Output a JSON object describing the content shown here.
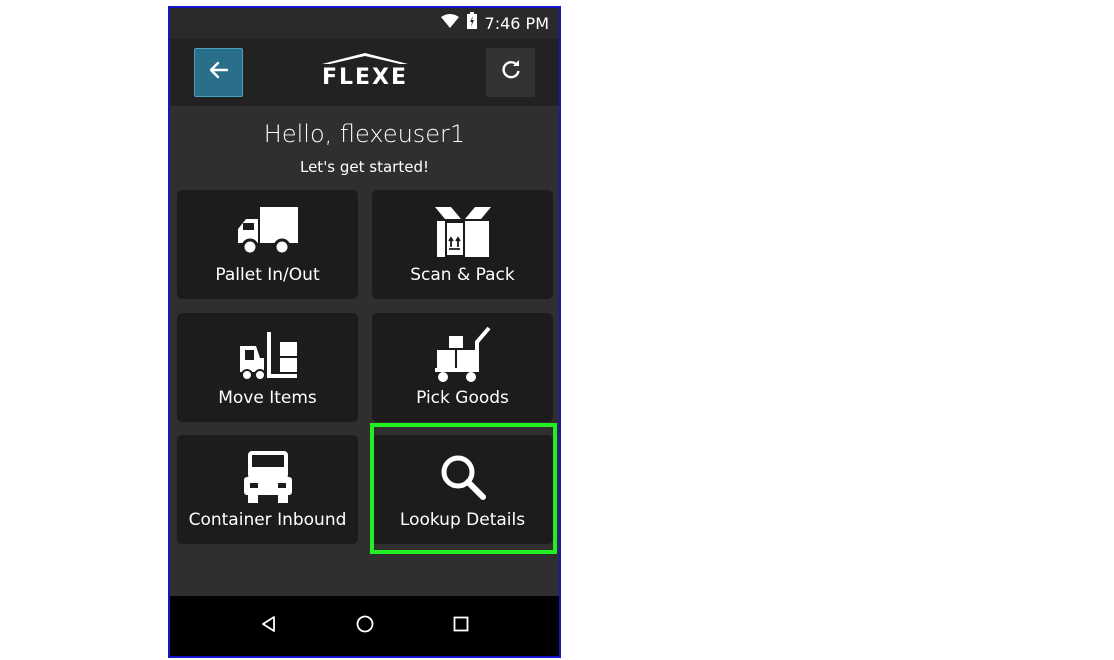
{
  "status_bar": {
    "time": "7:46 PM",
    "icons": [
      "wifi-icon",
      "battery-charging-icon"
    ]
  },
  "app_bar": {
    "brand": "FLEXE",
    "back_icon": "arrow-left-icon",
    "refresh_icon": "refresh-icon"
  },
  "greeting": {
    "title": "Hello, flexeuser1",
    "subtitle": "Let's get started!"
  },
  "tiles": [
    {
      "label": "Pallet In/Out",
      "icon": "truck-icon"
    },
    {
      "label": "Scan & Pack",
      "icon": "open-box-icon"
    },
    {
      "label": "Move Items",
      "icon": "forklift-icon"
    },
    {
      "label": "Pick Goods",
      "icon": "hand-cart-icon"
    },
    {
      "label": "Container Inbound",
      "icon": "semi-truck-icon"
    },
    {
      "label": "Lookup Details",
      "icon": "search-icon"
    }
  ],
  "highlighted_tile": "Lookup Details",
  "nav_bar": {
    "buttons": [
      "back-triangle-icon",
      "home-circle-icon",
      "recents-square-icon"
    ]
  },
  "colors": {
    "background": "#2f2f2f",
    "tile": "#1c1c1c",
    "back_button": "#2a6f8a",
    "highlight": "#22ee22"
  }
}
